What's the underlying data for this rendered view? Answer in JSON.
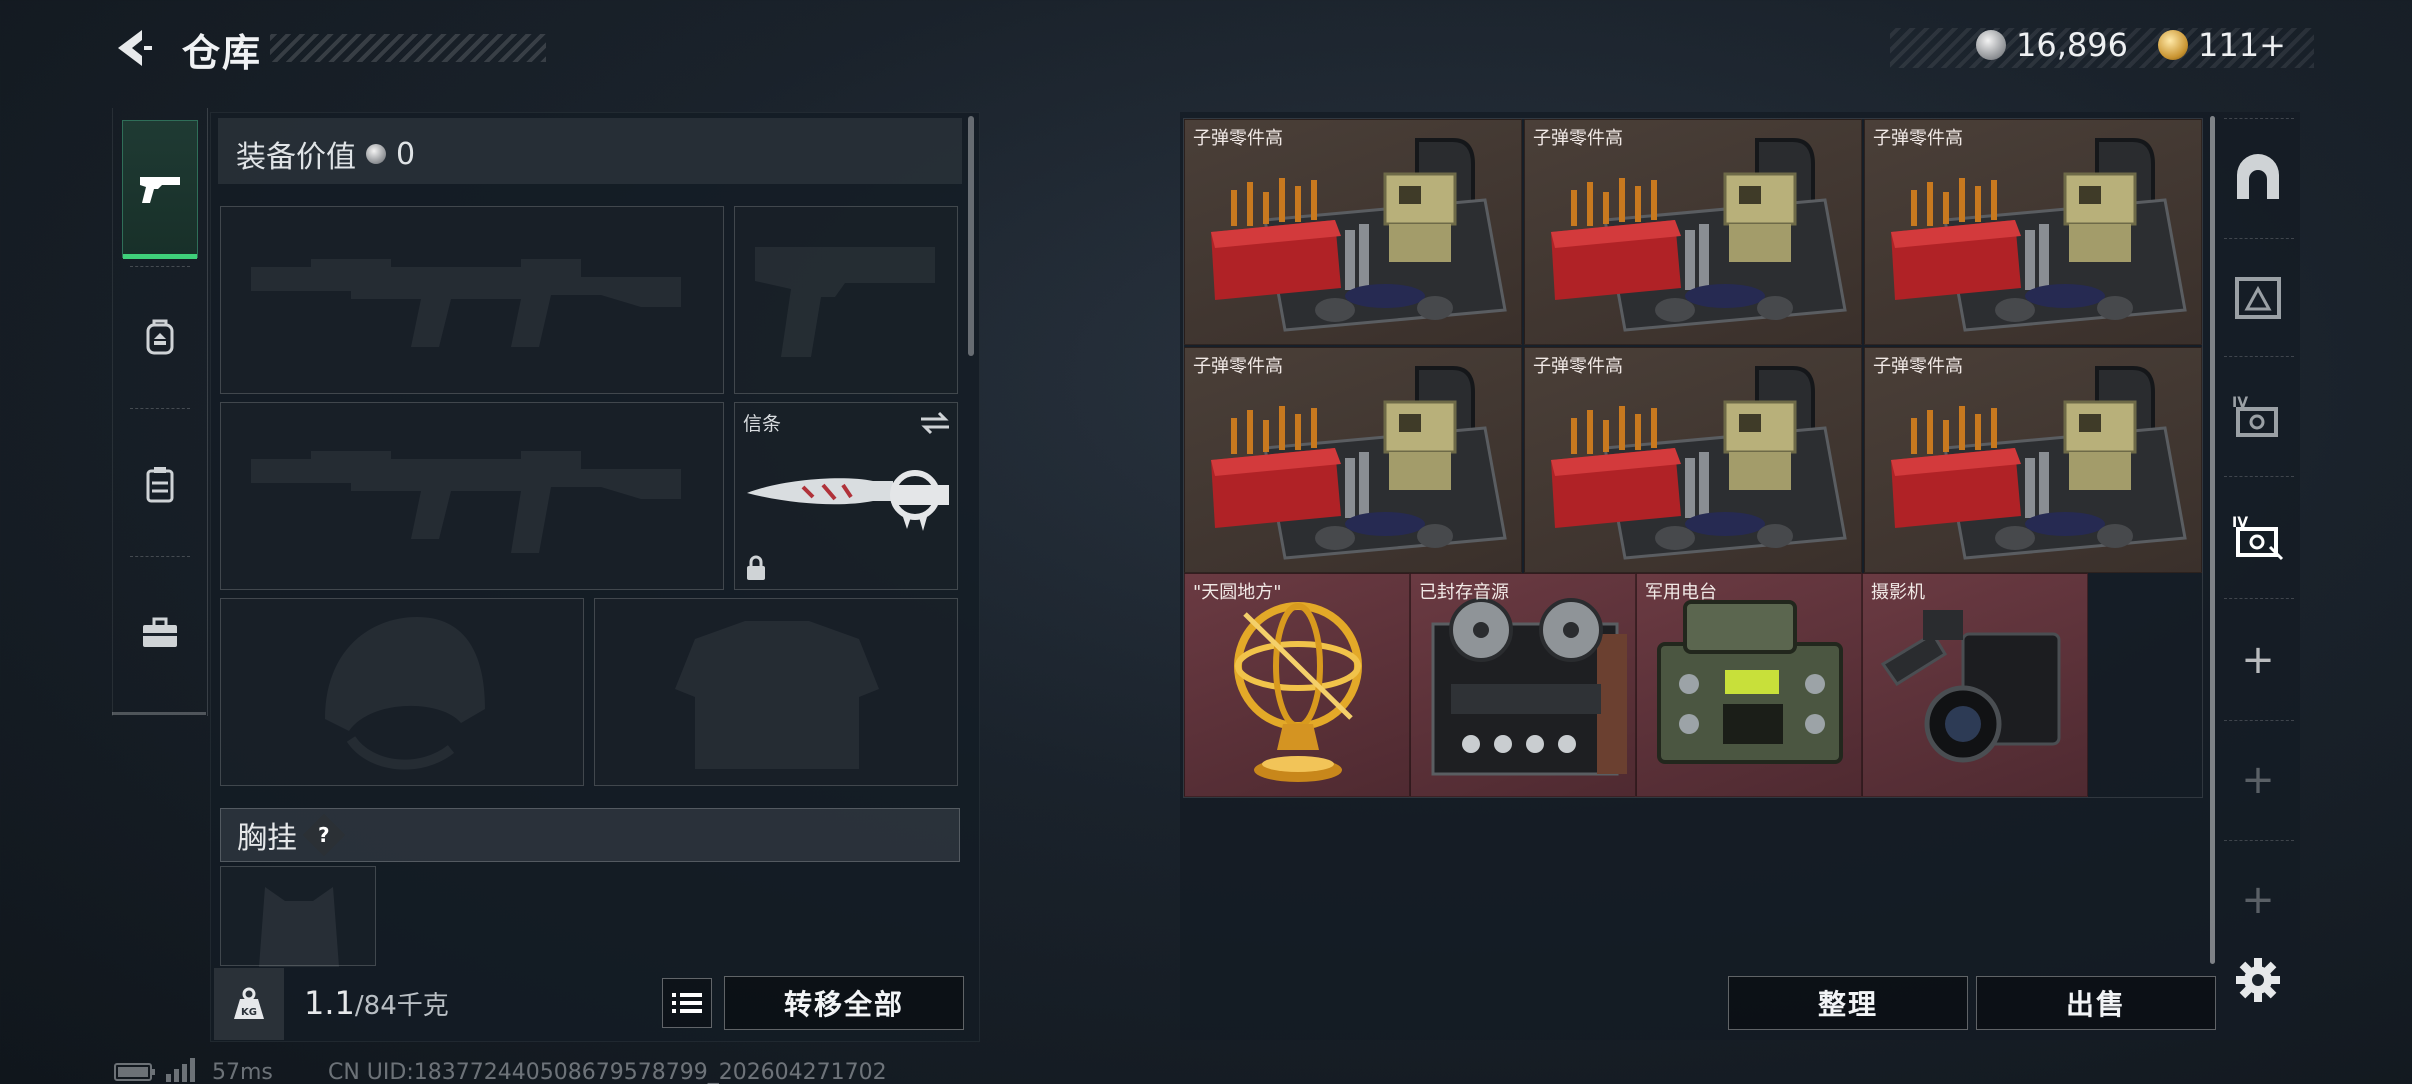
{
  "header": {
    "title": "仓库"
  },
  "currency": {
    "silver": "16,896",
    "gold": "111+"
  },
  "equipment": {
    "value_label": "装备价值",
    "value": "0",
    "melee_slot_title": "信条",
    "chest_label": "胸挂",
    "chest_help": "?"
  },
  "inventory": {
    "weight_current": "1.1",
    "weight_capacity": "/84千克",
    "weight_badge": "KG",
    "transfer_all": "转移全部"
  },
  "warehouse": {
    "items": [
      {
        "label": "子弹零件高",
        "kind": "ammo"
      },
      {
        "label": "子弹零件高",
        "kind": "ammo"
      },
      {
        "label": "子弹零件高",
        "kind": "ammo"
      },
      {
        "label": "子弹零件高",
        "kind": "ammo"
      },
      {
        "label": "子弹零件高",
        "kind": "ammo"
      },
      {
        "label": "子弹零件高",
        "kind": "ammo"
      },
      {
        "label": "\"天圆地方\"",
        "kind": "armillary"
      },
      {
        "label": "已封存音源",
        "kind": "reel"
      },
      {
        "label": "军用电台",
        "kind": "radio"
      },
      {
        "label": "摄影机",
        "kind": "camera"
      }
    ],
    "sort_button": "整理",
    "sell_button": "出售"
  },
  "side_rail": {
    "tier_badge_1": "IV",
    "tier_badge_2": "IV",
    "plus_1": "+",
    "plus_2": "+",
    "plus_3": "+"
  },
  "status": {
    "ping": "57ms",
    "uid": "CN UID:183772440508679578799_202604271702"
  },
  "colors": {
    "accent": "#3fd07a",
    "ammo_bg": "#4a3f38",
    "valuable_bg": "#6a3a42"
  }
}
